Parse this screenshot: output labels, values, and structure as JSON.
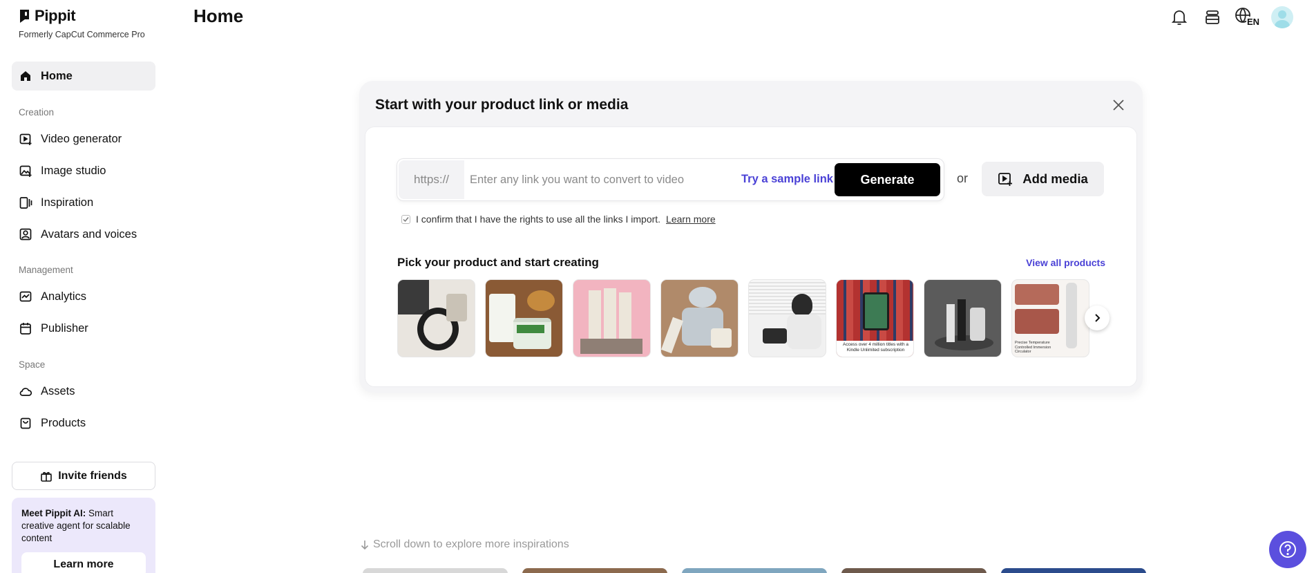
{
  "brand": {
    "name": "Pippit",
    "subtitle": "Formerly CapCut Commerce Pro"
  },
  "header": {
    "title": "Home",
    "language": "EN"
  },
  "sidebar": {
    "home": {
      "label": "Home",
      "icon": "home-icon"
    },
    "sections": [
      {
        "label": "Creation",
        "items": [
          {
            "label": "Video generator",
            "icon": "video-plus-icon"
          },
          {
            "label": "Image studio",
            "icon": "image-plus-icon"
          },
          {
            "label": "Inspiration",
            "icon": "inspiration-icon"
          },
          {
            "label": "Avatars and voices",
            "icon": "avatar-icon"
          }
        ]
      },
      {
        "label": "Management",
        "items": [
          {
            "label": "Analytics",
            "icon": "chart-icon"
          },
          {
            "label": "Publisher",
            "icon": "calendar-icon"
          }
        ]
      },
      {
        "label": "Space",
        "items": [
          {
            "label": "Assets",
            "icon": "cloud-icon"
          },
          {
            "label": "Products",
            "icon": "bag-icon"
          }
        ]
      }
    ],
    "invite_label": "Invite friends",
    "promo": {
      "bold": "Meet Pippit AI:",
      "text": " Smart creative agent for scalable content",
      "button": "Learn more"
    }
  },
  "card": {
    "title": "Start with your product link or media",
    "prefix": "https://",
    "placeholder": "Enter any link you want to convert to video",
    "sample_link": "Try a sample link",
    "generate": "Generate",
    "or": "or",
    "add_media": "Add media",
    "confirm_text": "I confirm that I have the rights to use all the links I import.",
    "confirm_link": "Learn more",
    "pick_title": "Pick your product and start creating",
    "view_all": "View all products",
    "products": [
      {
        "name": "headphones",
        "bg": "#e9e5df",
        "accent": "#2a2a2a"
      },
      {
        "name": "skincare-jar",
        "bg": "#8a5a35",
        "accent": "#e9efe6"
      },
      {
        "name": "pink-tubes",
        "bg": "#f2b4c0",
        "accent": "#e8e0d2"
      },
      {
        "name": "stone-cream",
        "bg": "#b08a6a",
        "accent": "#cfd6db"
      },
      {
        "name": "phone-desk",
        "bg": "#f1f1f1",
        "accent": "#2c2c2c"
      },
      {
        "name": "kindle",
        "bg": "#c43a36",
        "accent": "#3d7b54"
      },
      {
        "name": "bottles-dark",
        "bg": "#5b5b5b",
        "accent": "#d9d9d9"
      },
      {
        "name": "meat-sous-vide",
        "bg": "#f7f4f1",
        "accent": "#b56a5a"
      }
    ]
  },
  "kindle_caption": "Access over 4 million titles with a Kindle Unlimited subscription",
  "sous_vide_caption": "Precise Temperature Controlled Immersion Circulator",
  "scroll_hint": "Scroll down to explore more inspirations",
  "colors": {
    "accent": "#4a41d6",
    "fab": "#5b4fde",
    "promo_bg": "#ece8fb"
  }
}
